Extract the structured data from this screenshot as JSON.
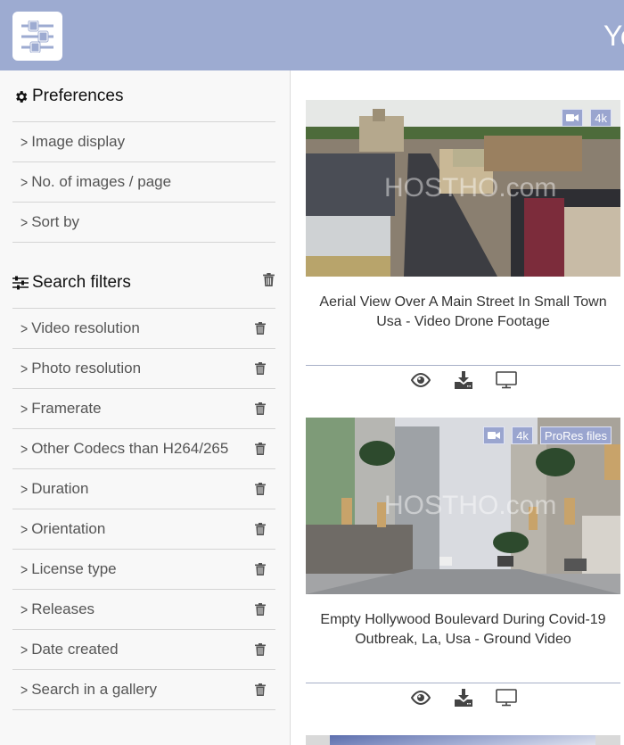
{
  "header": {
    "title": "Yo"
  },
  "sidebar": {
    "preferences": {
      "title": "Preferences",
      "items": [
        {
          "label": "Image display"
        },
        {
          "label": "No. of images / page"
        },
        {
          "label": "Sort by"
        }
      ]
    },
    "filters": {
      "title": "Search filters",
      "items": [
        {
          "label": "Video resolution"
        },
        {
          "label": "Photo resolution"
        },
        {
          "label": "Framerate"
        },
        {
          "label": "Other Codecs than H264/265"
        },
        {
          "label": "Duration"
        },
        {
          "label": "Orientation"
        },
        {
          "label": "License type"
        },
        {
          "label": "Releases"
        },
        {
          "label": "Date created"
        },
        {
          "label": "Search in a gallery"
        }
      ]
    }
  },
  "results": [
    {
      "title": "Aerial View Over A Main Street In Small Town Usa - Video Drone Footage",
      "badges": [
        "video",
        "4k"
      ],
      "watermark": "HOSTHO.com"
    },
    {
      "title": "Empty Hollywood Boulevard During Covid-19 Outbreak, La, Usa - Ground Video",
      "badges": [
        "video",
        "4k",
        "ProRes files"
      ],
      "watermark": "HOSTHO.com"
    }
  ],
  "badge_labels": {
    "k4": "4k",
    "prores": "ProRes files"
  },
  "colors": {
    "header": "#9dabd1",
    "badge": "#9aa5cf"
  }
}
